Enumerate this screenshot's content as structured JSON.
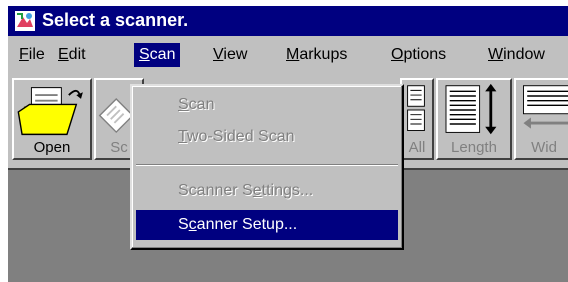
{
  "window": {
    "title": "Select a scanner."
  },
  "menubar": {
    "items": [
      {
        "label": "File",
        "accel": "F",
        "rest": "ile"
      },
      {
        "label": "Edit",
        "accel": "E",
        "rest": "dit"
      },
      {
        "label": "Scan",
        "accel": "S",
        "rest": "can"
      },
      {
        "label": "View",
        "accel": "V",
        "rest": "iew"
      },
      {
        "label": "Markups",
        "accel": "M",
        "rest": "arkups"
      },
      {
        "label": "Options",
        "accel": "O",
        "rest": "ptions"
      },
      {
        "label": "Window",
        "accel": "W",
        "rest": "indow"
      }
    ],
    "active": "Scan"
  },
  "toolbar": {
    "open_label": "Open",
    "scan_label": "Sc",
    "all_label": "All",
    "length_label": "Length",
    "width_label": "Wid"
  },
  "scan_menu": {
    "items": [
      {
        "label": "Scan",
        "pre": "",
        "accel": "S",
        "post": "can",
        "state": "disabled"
      },
      {
        "label": "Two-Sided Scan",
        "pre": "",
        "accel": "T",
        "post": "wo-Sided Scan",
        "state": "disabled"
      },
      {
        "label": "Scanner Settings...",
        "pre": "Scanner S",
        "accel": "e",
        "post": "ttings...",
        "state": "disabled"
      },
      {
        "label": "Scanner Setup...",
        "pre": "S",
        "accel": "c",
        "post": "anner Setup...",
        "state": "selected"
      }
    ]
  },
  "colors": {
    "titlebar": "#000080",
    "face": "#c0c0c0",
    "workspace": "#808080",
    "highlight": "#000080"
  }
}
